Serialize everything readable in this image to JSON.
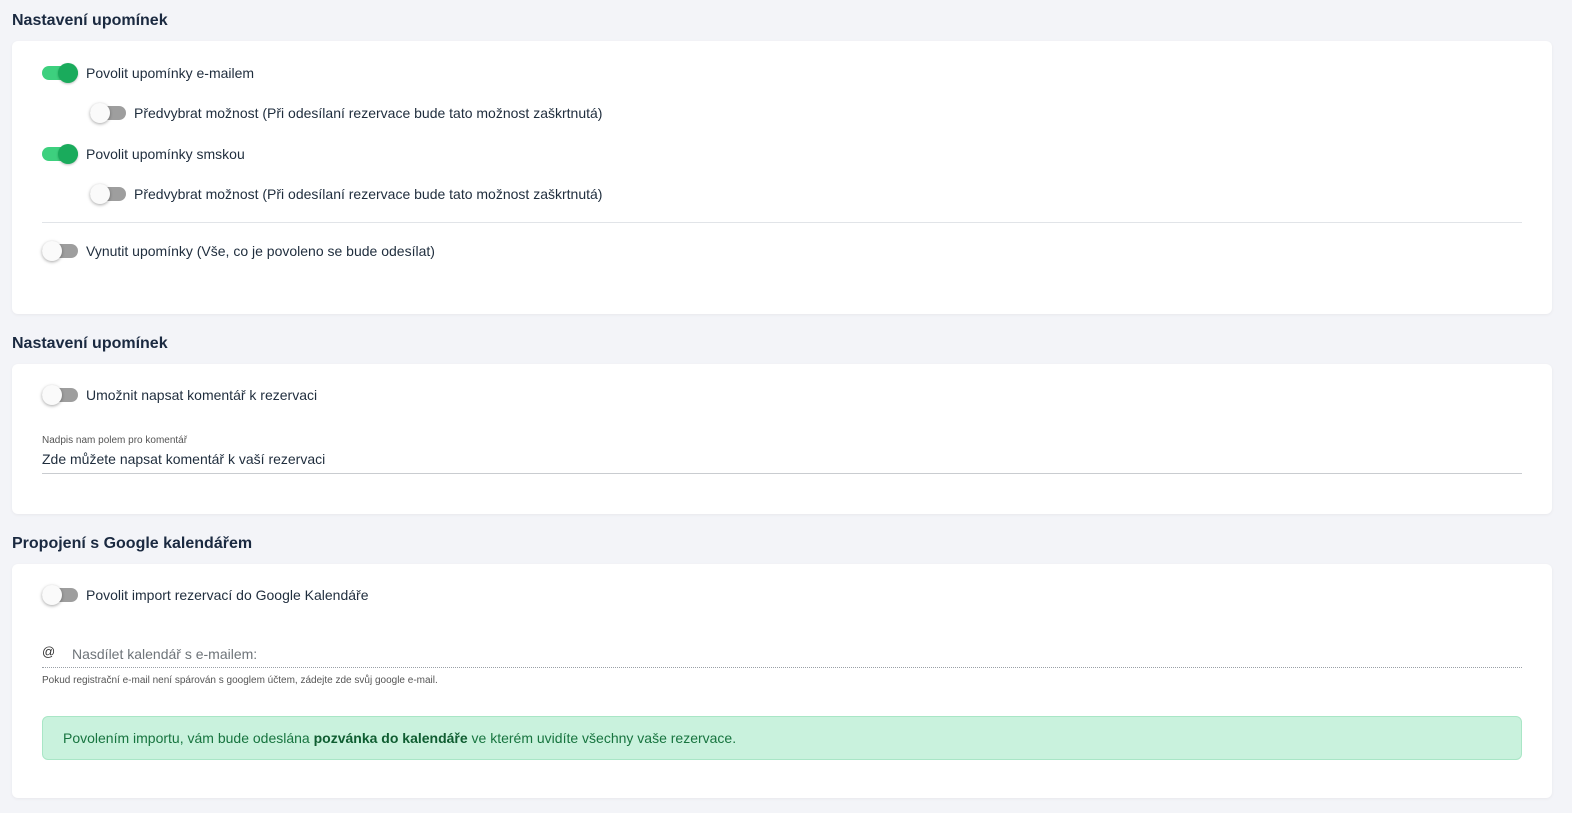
{
  "reminders": {
    "title": "Nastavení upomínek",
    "email_toggle": {
      "label": "Povolit upomínky e-mailem",
      "checked": true
    },
    "email_preselect": {
      "label": "Předvybrat možnost (Při odesílaní rezervace bude tato možnost zaškrtnutá)",
      "checked": false
    },
    "sms_toggle": {
      "label": "Povolit upomínky smskou",
      "checked": true
    },
    "sms_preselect": {
      "label": "Předvybrat možnost (Při odesílaní rezervace bude tato možnost zaškrtnutá)",
      "checked": false
    },
    "force_toggle": {
      "label": "Vynutit upomínky (Vše, co je povoleno se bude odesílat)",
      "checked": false
    }
  },
  "comments": {
    "title": "Nastavení upomínek",
    "allow_toggle": {
      "label": "Umožnit napsat komentář k rezervaci",
      "checked": false
    },
    "field_caption": "Nadpis nam polem pro komentář",
    "field_value": "Zde můžete napsat komentář k vaší rezervaci"
  },
  "google": {
    "title": "Propojení s Google kalendářem",
    "import_toggle": {
      "label": "Povolit import rezervací do Google Kalendáře",
      "checked": false
    },
    "email_icon": "@",
    "email_placeholder": "Nasdílet kalendář s e-mailem:",
    "email_hint": "Pokud registrační e-mail není spárován s googlem účtem, zádejte zde svůj google e-mail.",
    "alert": {
      "text_before": "Povolením importu, vám bude odeslána ",
      "text_bold": "pozvánka do kalendáře",
      "text_after": " ve kterém uvidíte všechny vaše rezervace."
    }
  },
  "colors": {
    "toggle_on_track": "#3dd07e",
    "toggle_on_thumb": "#1aab5c",
    "toggle_off_track": "#9e9e9e",
    "alert_bg": "#c9f2dd",
    "alert_text": "#17743f"
  }
}
